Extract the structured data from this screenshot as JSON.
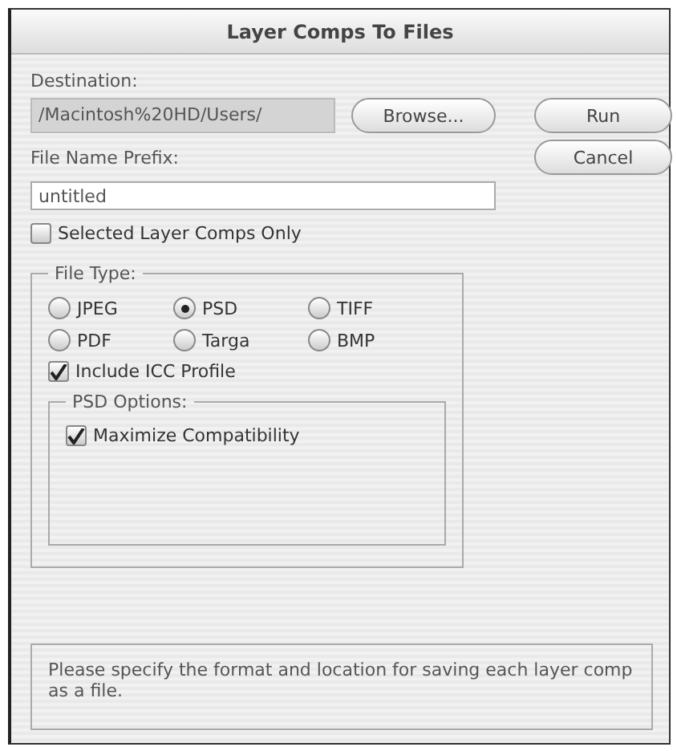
{
  "window": {
    "title": "Layer Comps To Files"
  },
  "destination": {
    "label": "Destination:",
    "value": "/Macintosh%20HD/Users/"
  },
  "browse_button": "Browse...",
  "buttons": [
    "Run",
    "Cancel"
  ],
  "file_name_prefix": {
    "label": "File Name Prefix:",
    "value": "untitled"
  },
  "selected_only": {
    "label": "Selected Layer Comps Only",
    "checked": false
  },
  "file_type": {
    "title": "File Type:",
    "options": [
      {
        "label": "JPEG",
        "selected": false
      },
      {
        "label": "PSD",
        "selected": true
      },
      {
        "label": "TIFF",
        "selected": false
      },
      {
        "label": "PDF",
        "selected": false
      },
      {
        "label": "Targa",
        "selected": false
      },
      {
        "label": "BMP",
        "selected": false
      }
    ],
    "include_icc": {
      "label": "Include ICC Profile",
      "checked": true
    },
    "psd_options": {
      "title": "PSD Options:",
      "maximize": {
        "label": "Maximize Compatibility",
        "checked": true
      }
    }
  },
  "message": "Please specify the format and location for saving each layer comp as a file."
}
